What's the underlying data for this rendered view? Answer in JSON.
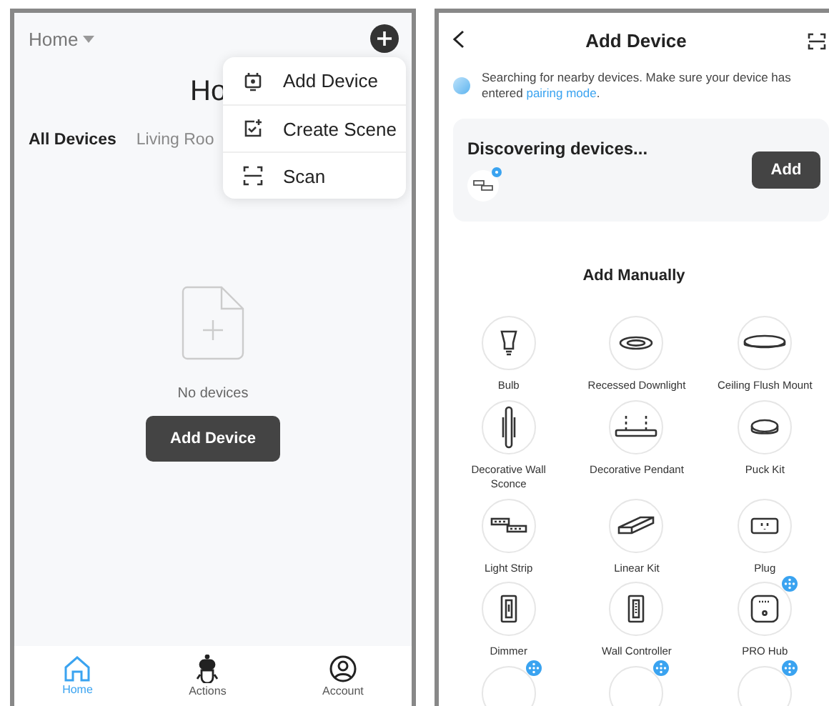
{
  "home_screen": {
    "home_selector": "Home",
    "title": "Ho",
    "tabs": [
      {
        "label": "All Devices",
        "selected": true
      },
      {
        "label": "Living Roo",
        "selected": false
      }
    ],
    "menu": [
      {
        "kind": "device",
        "label": "Add Device"
      },
      {
        "kind": "scene",
        "label": "Create Scene"
      },
      {
        "kind": "scan",
        "label": "Scan"
      }
    ],
    "empty_text": "No devices",
    "add_button": "Add Device",
    "nav": [
      {
        "kind": "home",
        "label": "Home",
        "selected": true
      },
      {
        "kind": "actions",
        "label": "Actions",
        "selected": false
      },
      {
        "kind": "account",
        "label": "Account",
        "selected": false
      }
    ]
  },
  "add_device_screen": {
    "title": "Add Device",
    "notice": {
      "text": "Searching for nearby devices. Make sure your device has entered",
      "link": "pairing mode",
      "tail": "."
    },
    "discovery": {
      "title": "Discovering devices...",
      "button": "Add"
    },
    "section_title": "Add Manually",
    "devices": [
      {
        "kind": "bulb",
        "label": "Bulb",
        "badge": false
      },
      {
        "kind": "downlight",
        "label": "Recessed Downlight",
        "badge": false
      },
      {
        "kind": "flush",
        "label": "Ceiling Flush Mount",
        "badge": false
      },
      {
        "kind": "sconce",
        "label": "Decorative Wall Sconce",
        "badge": false
      },
      {
        "kind": "pendant",
        "label": "Decorative Pendant",
        "badge": false
      },
      {
        "kind": "puck",
        "label": "Puck Kit",
        "badge": false
      },
      {
        "kind": "strip",
        "label": "Light Strip",
        "badge": false
      },
      {
        "kind": "linear",
        "label": "Linear Kit",
        "badge": false
      },
      {
        "kind": "plug",
        "label": "Plug",
        "badge": false
      },
      {
        "kind": "dimmer",
        "label": "Dimmer",
        "badge": false
      },
      {
        "kind": "controller",
        "label": "Wall Controller",
        "badge": false
      },
      {
        "kind": "hub",
        "label": "PRO Hub",
        "badge": true
      },
      {
        "kind": "hidden",
        "badge": true
      },
      {
        "kind": "hidden",
        "badge": true
      },
      {
        "kind": "hidden",
        "badge": true
      }
    ]
  }
}
